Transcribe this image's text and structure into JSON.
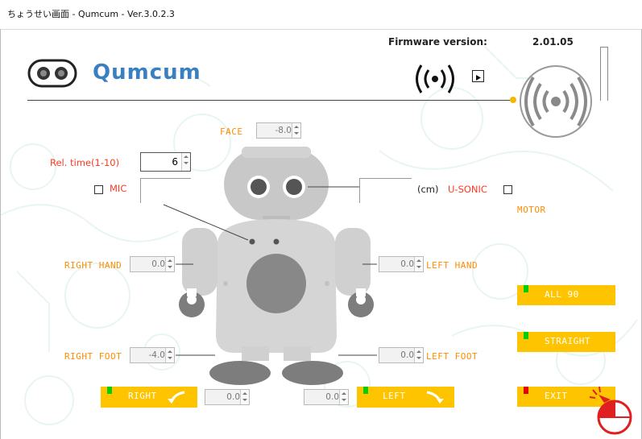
{
  "window": {
    "title": "ちょうせい画面 - Qumcum - Ver.3.0.2.3"
  },
  "header": {
    "logo_text": "Qumcum",
    "firmware_label": "Firmware version:",
    "firmware_value": "2.01.05",
    "wireless_icon": "broadcast-icon",
    "play_icon": "play-icon"
  },
  "face": {
    "label": "FACE",
    "value": "-8.0"
  },
  "reltime": {
    "label": "Rel. time(1-10)",
    "value": "6"
  },
  "mic": {
    "label": "MIC"
  },
  "usonic": {
    "unit": "(cm)",
    "label": "U-SONIC"
  },
  "motor": {
    "label": "MOTOR"
  },
  "right_hand": {
    "label": "RIGHT HAND",
    "value": "0.0"
  },
  "left_hand": {
    "label": "LEFT HAND",
    "value": "0.0"
  },
  "right_foot": {
    "label": "RIGHT FOOT",
    "value": "-4.0"
  },
  "left_foot": {
    "label": "LEFT FOOT",
    "value": "0.0"
  },
  "right_turn": {
    "label": "RIGHT",
    "value": "0.0",
    "led": "#00d000"
  },
  "left_turn": {
    "label": "LEFT",
    "value": "0.0",
    "led": "#00d000"
  },
  "buttons": {
    "all90": {
      "label": "ALL 90",
      "led": "#00d000"
    },
    "straight": {
      "label": "STRAIGHT",
      "led": "#00d000"
    },
    "exit": {
      "label": "EXIT",
      "led": "#e00000"
    }
  },
  "colors": {
    "accent": "#ff8c00",
    "button": "#ffc400",
    "label_red": "#ff3a22"
  }
}
